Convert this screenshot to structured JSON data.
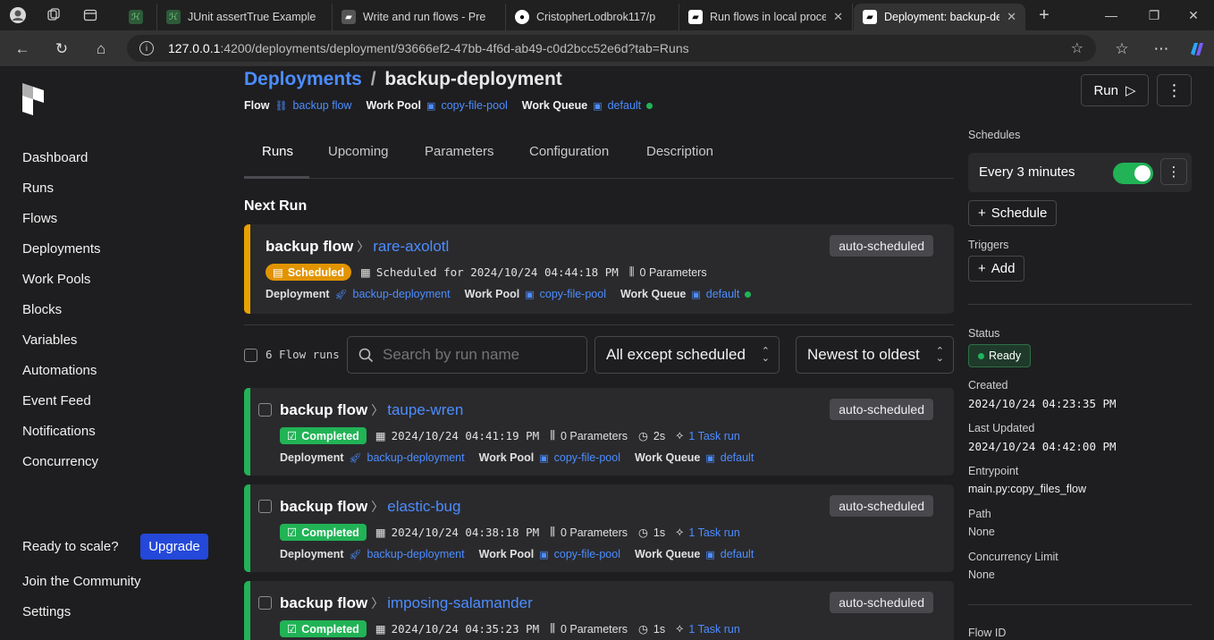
{
  "browser": {
    "tabs": [
      {
        "title": "",
        "icon": "green-logo"
      },
      {
        "title": "JUnit assertTrue Example",
        "icon": "green-logo"
      },
      {
        "title": "Write and run flows - Pre",
        "icon": "prefect-logo"
      },
      {
        "title": "CristopherLodbrok117/p",
        "icon": "github-logo"
      },
      {
        "title": "Run flows in local proces",
        "icon": "prefect-logo"
      },
      {
        "title": "Deployment: backup-dep",
        "icon": "prefect-logo"
      }
    ],
    "url_host": "127.0.0.1",
    "url_rest": ":4200/deployments/deployment/93666ef2-47bb-4f6d-ab49-c0d2bcc52e6d?tab=Runs"
  },
  "sidebar": {
    "items": [
      "Dashboard",
      "Runs",
      "Flows",
      "Deployments",
      "Work Pools",
      "Blocks",
      "Variables",
      "Automations",
      "Event Feed",
      "Notifications",
      "Concurrency"
    ],
    "ready_text": "Ready to scale?",
    "upgrade_label": "Upgrade",
    "community": "Join the Community",
    "settings": "Settings"
  },
  "header": {
    "breadcrumb_root": "Deployments",
    "breadcrumb_sep": "/",
    "breadcrumb_current": "backup-deployment",
    "flow_label": "Flow",
    "flow_value": "backup flow",
    "pool_label": "Work Pool",
    "pool_value": "copy-file-pool",
    "queue_label": "Work Queue",
    "queue_value": "default",
    "run_label": "Run"
  },
  "tabs": [
    "Runs",
    "Upcoming",
    "Parameters",
    "Configuration",
    "Description"
  ],
  "next_run": {
    "heading": "Next Run",
    "flow": "backup flow",
    "run": "rare-axolotl",
    "tag": "auto-scheduled",
    "state": "Scheduled",
    "scheduled_for": "Scheduled for 2024/10/24 04:44:18 PM",
    "params": "0 Parameters",
    "deployment_label": "Deployment",
    "deployment": "backup-deployment",
    "pool_label": "Work Pool",
    "pool": "copy-file-pool",
    "queue_label": "Work Queue",
    "queue": "default"
  },
  "filters": {
    "count": "6 Flow runs",
    "search_placeholder": "Search by run name",
    "state_filter": "All except scheduled",
    "sort": "Newest to oldest"
  },
  "runs": [
    {
      "flow": "backup flow",
      "run": "taupe-wren",
      "tag": "auto-scheduled",
      "state": "Completed",
      "time": "2024/10/24 04:41:19 PM",
      "params": "0 Parameters",
      "duration": "2s",
      "tasks": "1 Task run",
      "deployment": "backup-deployment",
      "pool": "copy-file-pool",
      "queue": "default"
    },
    {
      "flow": "backup flow",
      "run": "elastic-bug",
      "tag": "auto-scheduled",
      "state": "Completed",
      "time": "2024/10/24 04:38:18 PM",
      "params": "0 Parameters",
      "duration": "1s",
      "tasks": "1 Task run",
      "deployment": "backup-deployment",
      "pool": "copy-file-pool",
      "queue": "default"
    },
    {
      "flow": "backup flow",
      "run": "imposing-salamander",
      "tag": "auto-scheduled",
      "state": "Completed",
      "time": "2024/10/24 04:35:23 PM",
      "params": "0 Parameters",
      "duration": "1s",
      "tasks": "1 Task run"
    }
  ],
  "labels": {
    "deployment": "Deployment",
    "pool": "Work Pool",
    "queue": "Work Queue"
  },
  "details": {
    "schedules_label": "Schedules",
    "schedule": "Every 3 minutes",
    "add_schedule": "Schedule",
    "triggers_label": "Triggers",
    "add_trigger": "Add",
    "status_label": "Status",
    "status": "Ready",
    "created_label": "Created",
    "created": "2024/10/24 04:23:35 PM",
    "updated_label": "Last Updated",
    "updated": "2024/10/24 04:42:00 PM",
    "entrypoint_label": "Entrypoint",
    "entrypoint": "main.py:copy_files_flow",
    "path_label": "Path",
    "path": "None",
    "concurrency_label": "Concurrency Limit",
    "concurrency": "None",
    "flow_id_label": "Flow ID"
  },
  "colors": {
    "accent": "#4c8dff",
    "scheduled": "#e29400",
    "completed": "#21b356"
  }
}
